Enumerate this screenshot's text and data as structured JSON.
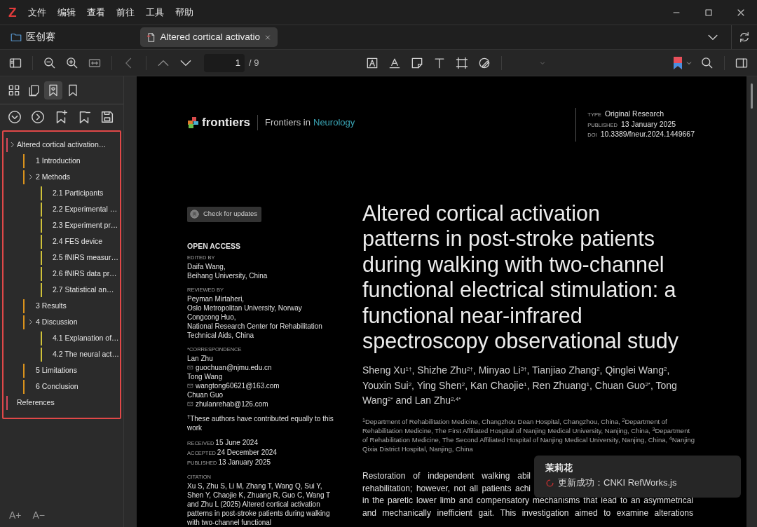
{
  "app_logo": "Z",
  "menu": [
    "文件",
    "编辑",
    "查看",
    "前往",
    "工具",
    "帮助"
  ],
  "tabs": [
    {
      "kind": "library",
      "label": "医创赛",
      "selected": false
    },
    {
      "kind": "document",
      "label": "Altered cortical activatio",
      "selected": true
    }
  ],
  "toolbar": {
    "page": "1",
    "page_total": "/ 9"
  },
  "sidebar": {
    "tabs": [
      {
        "kind": "thumbnails",
        "selected": false
      },
      {
        "kind": "annotations",
        "selected": false
      },
      {
        "kind": "outline",
        "selected": true
      },
      {
        "kind": "bookmarks",
        "selected": false
      }
    ],
    "outline": [
      {
        "label": "Altered cortical activation…",
        "children": [
          {
            "label": "1 Introduction"
          },
          {
            "label": "2 Methods",
            "children": [
              {
                "label": "2.1 Participants"
              },
              {
                "label": "2.2 Experimental …"
              },
              {
                "label": "2.3 Experiment pr…"
              },
              {
                "label": "2.4 FES device"
              },
              {
                "label": "2.5 fNIRS measur…"
              },
              {
                "label": "2.6 fNIRS data pr…"
              },
              {
                "label": "2.7 Statistical an…"
              }
            ]
          },
          {
            "label": "3 Results"
          },
          {
            "label": "4 Discussion",
            "children": [
              {
                "label": "4.1 Explanation of…"
              },
              {
                "label": "4.2 The neural act…"
              }
            ]
          },
          {
            "label": "5 Limitations"
          },
          {
            "label": "6 Conclusion"
          }
        ]
      },
      {
        "label": "References"
      }
    ],
    "font_buttons": [
      "A+",
      "A−"
    ]
  },
  "document": {
    "brand": "frontiers",
    "journal_prefix": "Frontiers in",
    "journal_name": "Neurology",
    "meta": [
      {
        "label": "TYPE",
        "value": "Original Research"
      },
      {
        "label": "PUBLISHED",
        "value": "13 January 2025"
      },
      {
        "label": "DOI",
        "value": "10.3389/fneur.2024.1449667"
      }
    ],
    "check_updates": "Check for updates",
    "open_access": "OPEN ACCESS",
    "sections": [
      {
        "label": "EDITED BY",
        "lines": [
          {
            "kind": "text",
            "text": "Daifa Wang,"
          },
          {
            "kind": "text",
            "text": "Beihang University, China"
          }
        ]
      },
      {
        "label": "REVIEWED BY",
        "lines": [
          {
            "kind": "text",
            "text": "Peyman Mirtaheri,"
          },
          {
            "kind": "text",
            "text": "Oslo Metropolitan University, Norway"
          },
          {
            "kind": "text",
            "text": "Congcong Huo,"
          },
          {
            "kind": "text",
            "text": "National Research Center for Rehabilitation"
          },
          {
            "kind": "text",
            "text": "Technical Aids, China"
          }
        ]
      },
      {
        "label": "*CORRESPONDENCE",
        "lines": [
          {
            "kind": "text",
            "text": "Lan Zhu"
          },
          {
            "kind": "email",
            "text": "guochuan@njmu.edu.cn"
          },
          {
            "kind": "text",
            "text": "Tong Wang"
          },
          {
            "kind": "email",
            "text": "wangtong60621@163.com"
          },
          {
            "kind": "text",
            "text": "Chuan Guo"
          },
          {
            "kind": "email",
            "text": "zhulanrehab@126.com"
          }
        ]
      }
    ],
    "footnote": "$^{†}$These authors have contributed equally to this work",
    "dates": [
      {
        "label": "RECEIVED",
        "value": "15 June 2024"
      },
      {
        "label": "ACCEPTED",
        "value": "24 December 2024"
      },
      {
        "label": "PUBLISHED",
        "value": "13 January 2025"
      }
    ],
    "citation_label": "CITATION",
    "citation": "Xu S, Zhu S, Li M, Zhang T, Wang Q, Sui Y, Shen Y, Chaojie K, Zhuang R, Guo C, Wang T and Zhu L (2025) Altered cortical activation patterns in post-stroke patients during walking with two-channel functional",
    "title": "Altered cortical activation patterns in post-stroke patients during walking with two-channel functional electrical stimulation: a functional near-infrared spectroscopy observational study",
    "authors": [
      {
        "name": "Sheng Xu",
        "sup": "1†",
        "after": ", "
      },
      {
        "name": "Shizhe Zhu",
        "sup": "2†",
        "after": ", "
      },
      {
        "name": "Minyao Li",
        "sup": "3†",
        "after": ", "
      },
      {
        "name": "Tianjiao Zhang",
        "sup": "2",
        "after": ", "
      },
      {
        "name": "Qinglei Wang",
        "sup": "2",
        "after": ", "
      },
      {
        "name": "Youxin Sui",
        "sup": "2",
        "after": ", "
      },
      {
        "name": "Ying Shen",
        "sup": "2",
        "after": ", "
      },
      {
        "name": "Kan Chaojie",
        "sup": "1",
        "after": ", "
      },
      {
        "name": "Ren Zhuang",
        "sup": "1",
        "after": ", "
      },
      {
        "name": "Chuan Guo",
        "sup": "2*",
        "after": ", "
      },
      {
        "name": "Tong Wang",
        "sup": "2*",
        "after": " and "
      },
      {
        "name": "Lan Zhu",
        "sup": "2,4*"
      }
    ],
    "affiliations": "$^{1}$Department of Rehabilitation Medicine, Changzhou Dean Hospital, Changzhou, China, $^{2}$Department of Rehabilitation Medicine, The First Affiliated Hospital of Nanjing Medical University, Nanjing, China, $^{3}$Department of Rehabilitation Medicine, The Second Affiliated Hospital of Nanjing Medical University, Nanjing, China, $^{4}$Nanjing Qixia District Hospital, Nanjing, China",
    "body_lines": [
      {
        "kind": "partial",
        "text": "Restoration of independent walking abil"
      },
      {
        "kind": "partial",
        "text": "rehabilitation; however, not all patients achi"
      },
      {
        "kind": "full",
        "text": "in the paretic lower limb and compensatory mechanisms that lead to an asymmetrical"
      },
      {
        "kind": "full",
        "text": "and mechanically inefficient gait. This investigation aimed to examine alterations"
      }
    ]
  },
  "toast": {
    "title": "茉莉花",
    "message": "更新成功：CNKI RefWorks.js"
  }
}
